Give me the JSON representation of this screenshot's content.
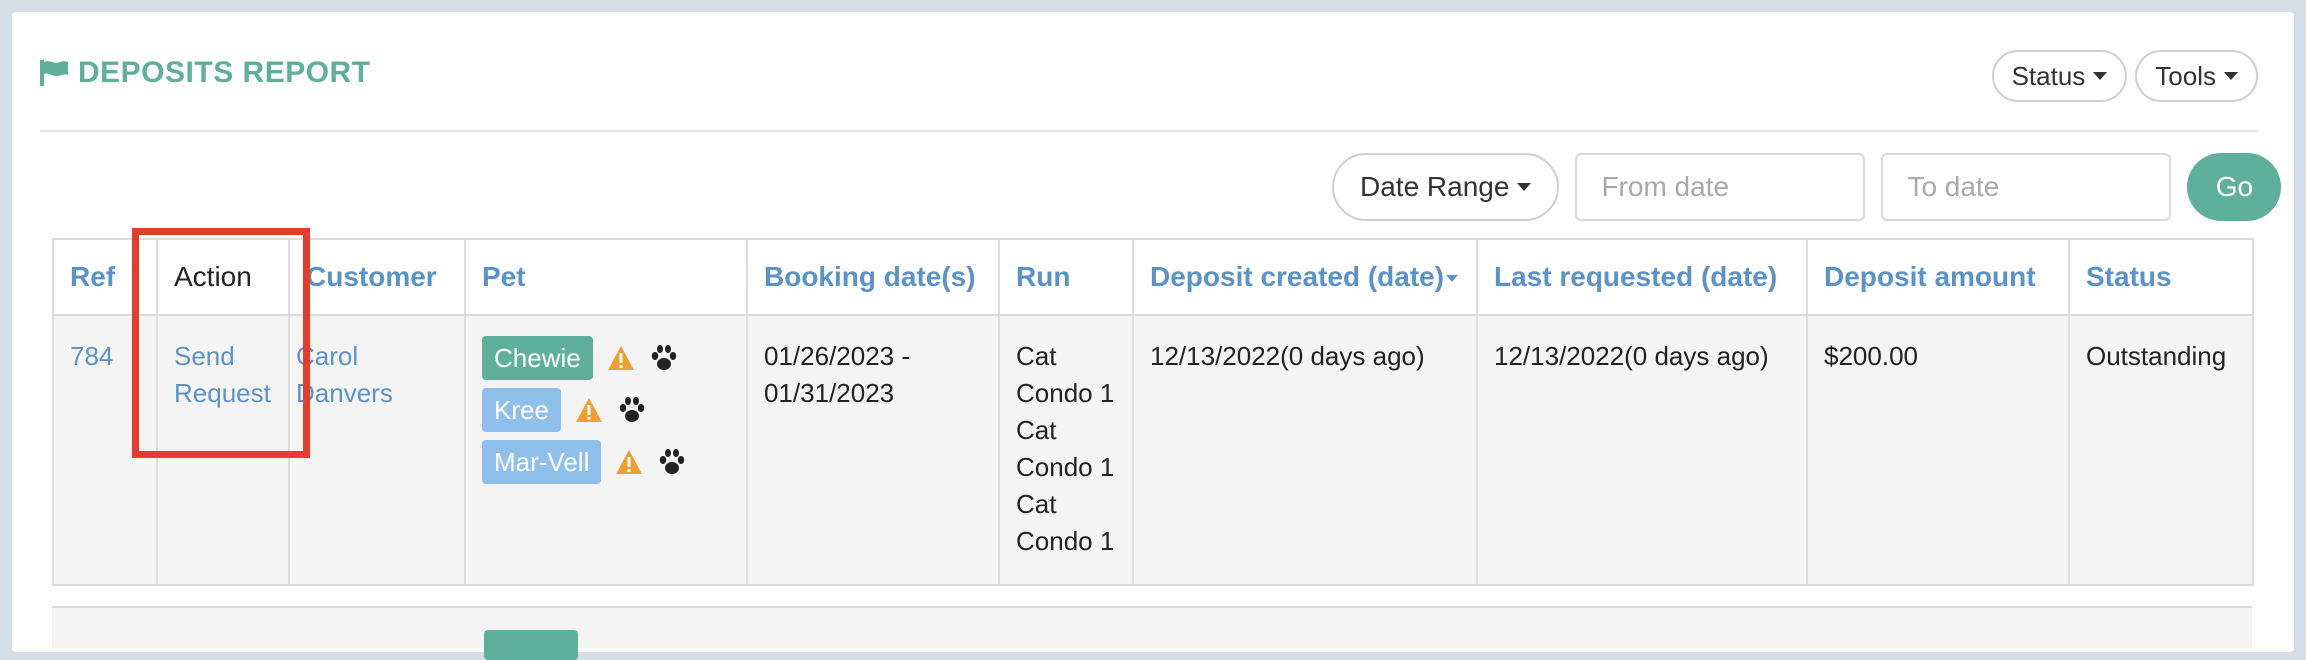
{
  "header": {
    "title": "DEPOSITS REPORT",
    "status_label": "Status",
    "tools_label": "Tools"
  },
  "filters": {
    "date_range_label": "Date Range",
    "from_placeholder": "From date",
    "to_placeholder": "To date",
    "go_label": "Go"
  },
  "table": {
    "columns": [
      "Ref",
      "Action",
      "Customer",
      "Pet",
      "Booking date(s)",
      "Run",
      "Deposit created (date)",
      "Last requested (date)",
      "Deposit amount",
      "Status"
    ],
    "sorted_column": "Deposit created (date)",
    "rows": [
      {
        "ref": "784",
        "action": "Send Request",
        "customer": "Carol Danvers",
        "pets": [
          {
            "name": "Chewie",
            "color": "#5fb09a"
          },
          {
            "name": "Kree",
            "color": "#8fc0ec"
          },
          {
            "name": "Mar-Vell",
            "color": "#8fc0ec"
          }
        ],
        "booking_dates": "01/26/2023 - 01/31/2023",
        "run": "Cat Condo 1 Cat Condo 1 Cat Condo 1",
        "deposit_created": "12/13/2022(0 days ago)",
        "last_requested": "12/13/2022(0 days ago)",
        "deposit_amount": "$200.00",
        "status": "Outstanding"
      }
    ]
  },
  "colors": {
    "accent": "#5fb09a",
    "link": "#5b93c9",
    "highlight": "#e53c2c",
    "warning": "#f0a030"
  }
}
